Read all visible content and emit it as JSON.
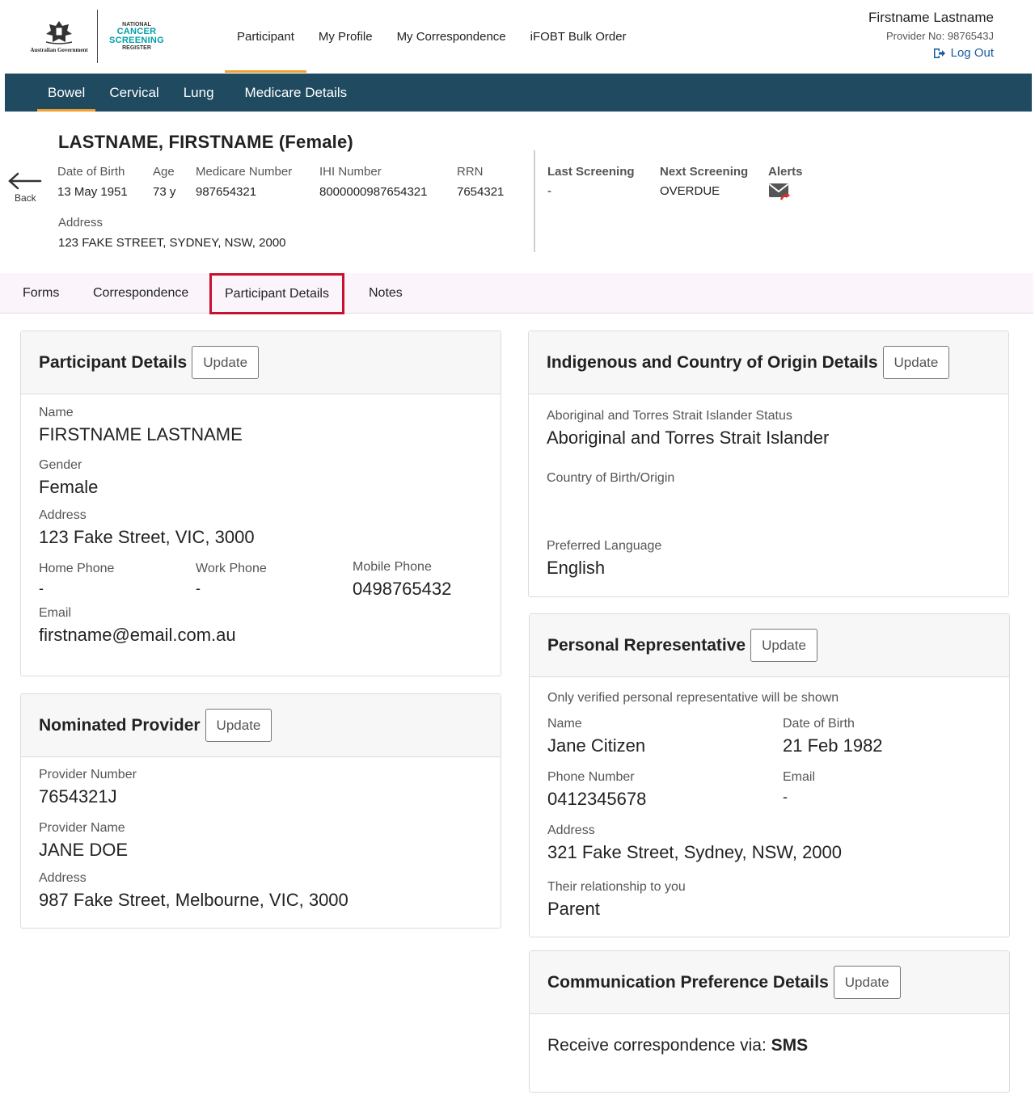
{
  "header": {
    "gov_text": "Australian Government",
    "ncsr_lines": [
      "NATIONAL",
      "CANCER",
      "SCREENING",
      "REGISTER"
    ],
    "nav": [
      "Participant",
      "My Profile",
      "My Correspondence",
      "iFOBT Bulk Order"
    ],
    "active_nav": "Participant",
    "user_name": "Firstname Lastname",
    "provider_no": "Provider No: 9876543J",
    "logout": "Log Out"
  },
  "sub_nav": [
    "Bowel",
    "Cervical",
    "Lung",
    "Medicare Details"
  ],
  "banner": {
    "back": "Back",
    "name": "LASTNAME, FIRSTNAME (Female)",
    "dob_label": "Date of Birth",
    "dob": "13 May 1951",
    "age_label": "Age",
    "age": "73 y",
    "medicare_label": "Medicare Number",
    "medicare": "987654321",
    "ihi_label": "IHI Number",
    "ihi": "8000000987654321",
    "rrn_label": "RRN",
    "rrn": "7654321",
    "address_label": "Address",
    "address": "123 FAKE STREET, SYDNEY, NSW, 2000",
    "last_screening_label": "Last Screening",
    "last_screening": "-",
    "next_screening_label": "Next Screening",
    "next_screening": "OVERDUE",
    "alerts_label": "Alerts"
  },
  "tabs": [
    "Forms",
    "Correspondence",
    "Participant Details",
    "Notes"
  ],
  "update_label": "Update",
  "participant_details": {
    "title": "Participant Details",
    "name_label": "Name",
    "name": "FIRSTNAME LASTNAME",
    "gender_label": "Gender",
    "gender": "Female",
    "address_label": "Address",
    "address": "123 Fake Street, VIC, 3000",
    "home_phone_label": "Home Phone",
    "home_phone": "-",
    "work_phone_label": "Work Phone",
    "work_phone": "-",
    "mobile_phone_label": "Mobile Phone",
    "mobile_phone": "0498765432",
    "email_label": "Email",
    "email": "firstname@email.com.au"
  },
  "nominated_provider": {
    "title": "Nominated Provider",
    "number_label": "Provider Number",
    "number": "7654321J",
    "name_label": "Provider Name",
    "name": "JANE DOE",
    "address_label": "Address",
    "address": "987 Fake Street, Melbourne, VIC, 3000"
  },
  "indigenous": {
    "title": "Indigenous and Country of Origin Details",
    "status_label": "Aboriginal and Torres Strait Islander Status",
    "status": "Aboriginal and Torres Strait Islander",
    "country_label": "Country of Birth/Origin",
    "language_label": "Preferred Language",
    "language": "English"
  },
  "personal_rep": {
    "title": "Personal Representative",
    "note": "Only verified personal representative will be shown",
    "name_label": "Name",
    "name": "Jane Citizen",
    "dob_label": "Date of Birth",
    "dob": "21 Feb 1982",
    "phone_label": "Phone Number",
    "phone": "0412345678",
    "email_label": "Email",
    "email": "-",
    "address_label": "Address",
    "address": "321 Fake Street, Sydney, NSW, 2000",
    "relationship_label": "Their relationship to you",
    "relationship": "Parent"
  },
  "communication": {
    "title": "Communication Preference Details",
    "prefix": "Receive correspondence via: ",
    "value": "SMS"
  }
}
